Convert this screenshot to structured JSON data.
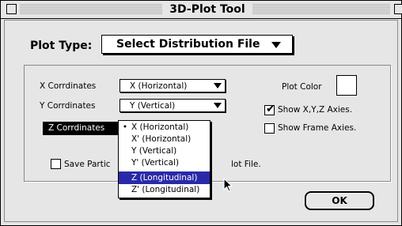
{
  "window": {
    "title": "3D-Plot Tool"
  },
  "plot_type": {
    "label": "Plot Type:",
    "selected": "Select Distribution File"
  },
  "x_coord": {
    "label": "X Corrdinates",
    "selected": "X (Horizontal)"
  },
  "y_coord": {
    "label": "Y Corrdinates",
    "selected": "Y (Vertical)"
  },
  "z_coord": {
    "label": "Z Corrdinates",
    "options": [
      {
        "mark": "•",
        "label": "X (Horizontal)"
      },
      {
        "mark": "",
        "label": "X' (Horizontal)"
      },
      {
        "mark": "",
        "label": "Y (Vertical)"
      },
      {
        "mark": "",
        "label": "Y' (Vertical)"
      },
      {
        "mark": "",
        "label": "Z (Longitudinal)"
      },
      {
        "mark": "",
        "label": "Z' (Longitudinal)"
      }
    ],
    "highlighted": "Z (Longitudinal)"
  },
  "plot_color": {
    "label": "Plot Color",
    "color": "#ffffff"
  },
  "show_xyz_axes": {
    "label": "Show X,Y,Z Axies.",
    "checked": true
  },
  "show_frame_axes": {
    "label": "Show Frame Axies.",
    "checked": false
  },
  "save_particles": {
    "label_left": "Save Partic",
    "label_right": "lot File.",
    "checked": false
  },
  "ok_button": {
    "label": "OK"
  },
  "icons": {
    "check": "✔"
  },
  "colors": {
    "highlight": "#2a2aa8",
    "window_bg": "#e6e6e6"
  }
}
